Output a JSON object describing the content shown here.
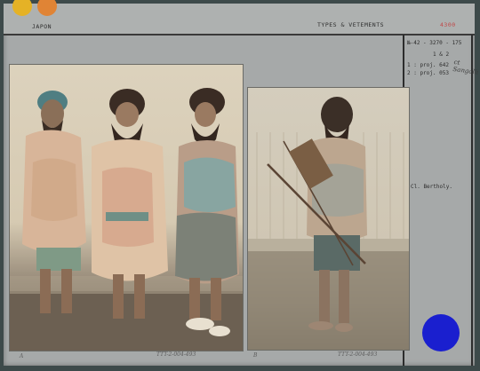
{
  "header": {
    "country": "JAPON",
    "category": "TYPES & VETEMENTS",
    "number": "4300"
  },
  "reference": {
    "line1": "№-42 - 3270 - 175",
    "line2": "1 & 2",
    "line3": "1 : proj. 642",
    "line4": "2 : proj. 053",
    "handwritten": "ct Sangalli"
  },
  "photos": [
    {
      "letter": "A",
      "catalog": "TTT-2-004-493"
    },
    {
      "letter": "B",
      "catalog": "TTT-2-004-493"
    }
  ],
  "side_note": "Cl. Bertholy.",
  "colors": {
    "card": "#a6a9a9",
    "accent_dot": "#1a1fcf"
  }
}
